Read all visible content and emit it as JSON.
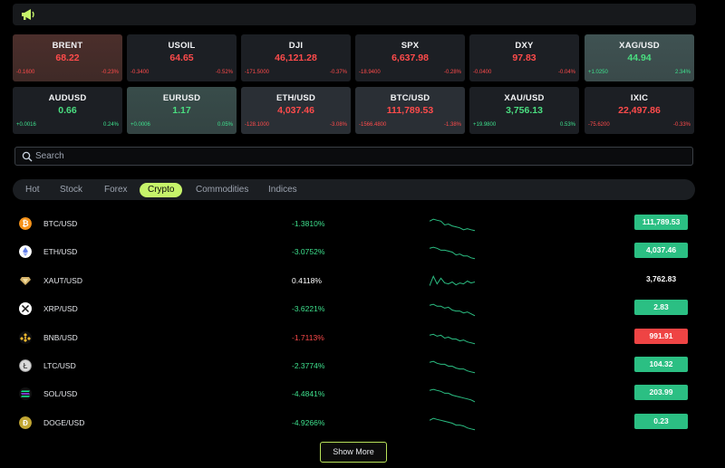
{
  "topbar": {
    "icon": "megaphone-icon"
  },
  "tiles": [
    {
      "symbol": "BRENT",
      "price": "68.22",
      "change": "-0.1600",
      "percent": "-0.23%",
      "dir": "down",
      "style": "hl-red"
    },
    {
      "symbol": "USOIL",
      "price": "64.65",
      "change": "-0.3400",
      "percent": "-0.52%",
      "dir": "down",
      "style": ""
    },
    {
      "symbol": "DJI",
      "price": "46,121.28",
      "change": "-171.5000",
      "percent": "-0.37%",
      "dir": "down",
      "style": ""
    },
    {
      "symbol": "SPX",
      "price": "6,637.98",
      "change": "-18.9400",
      "percent": "-0.28%",
      "dir": "down",
      "style": ""
    },
    {
      "symbol": "DXY",
      "price": "97.83",
      "change": "-0.0400",
      "percent": "-0.04%",
      "dir": "down",
      "style": ""
    },
    {
      "symbol": "XAG/USD",
      "price": "44.94",
      "change": "+1.0250",
      "percent": "2.34%",
      "dir": "up",
      "style": "hl-green"
    },
    {
      "symbol": "AUDUSD",
      "price": "0.66",
      "change": "+0.0016",
      "percent": "0.24%",
      "dir": "up",
      "style": ""
    },
    {
      "symbol": "EURUSD",
      "price": "1.17",
      "change": "+0.0006",
      "percent": "0.05%",
      "dir": "up",
      "style": "hl-green-2"
    },
    {
      "symbol": "ETH/USD",
      "price": "4,037.46",
      "change": "-128.1000",
      "percent": "-3.08%",
      "dir": "down",
      "style": "hl-gray"
    },
    {
      "symbol": "BTC/USD",
      "price": "111,789.53",
      "change": "-1566.4800",
      "percent": "-1.38%",
      "dir": "down",
      "style": "hl-gray"
    },
    {
      "symbol": "XAU/USD",
      "price": "3,756.13",
      "change": "+19.9800",
      "percent": "0.53%",
      "dir": "up",
      "style": ""
    },
    {
      "symbol": "IXIC",
      "price": "22,497.86",
      "change": "-75.6200",
      "percent": "-0.33%",
      "dir": "down",
      "style": ""
    }
  ],
  "search": {
    "placeholder": "Search",
    "value": ""
  },
  "tabs": [
    {
      "label": "Hot",
      "active": false
    },
    {
      "label": "Stock",
      "active": false
    },
    {
      "label": "Forex",
      "active": false
    },
    {
      "label": "Crypto",
      "active": true
    },
    {
      "label": "Commodities",
      "active": false
    },
    {
      "label": "Indices",
      "active": false
    }
  ],
  "rows": [
    {
      "pair": "BTC/USD",
      "percent": "-1.3810%",
      "pct_color": "pos",
      "price": "111,789.53",
      "price_style": "up",
      "icon": "bitcoin-icon",
      "icon_color": "#f7931a",
      "spark": [
        6,
        4,
        5,
        6,
        10,
        9,
        11,
        12,
        13,
        15,
        14,
        15,
        16
      ]
    },
    {
      "pair": "ETH/USD",
      "percent": "-3.0752%",
      "pct_color": "pos",
      "price": "4,037.46",
      "price_style": "up",
      "icon": "ethereum-icon",
      "icon_color": "#ffffff",
      "spark": [
        5,
        4,
        5,
        7,
        7,
        8,
        9,
        12,
        11,
        13,
        13,
        15,
        16
      ]
    },
    {
      "pair": "XAUT/USD",
      "percent": "0.4118%",
      "pct_color": "neu",
      "price": "3,762.83",
      "price_style": "flat",
      "icon": "tether-gold-icon",
      "icon_color": "#d4b26a",
      "spark": [
        14,
        4,
        12,
        6,
        11,
        12,
        10,
        13,
        11,
        12,
        9,
        11,
        10
      ]
    },
    {
      "pair": "XRP/USD",
      "percent": "-3.6221%",
      "pct_color": "pos",
      "price": "2.83",
      "price_style": "up",
      "icon": "xrp-icon",
      "icon_color": "#ffffff",
      "spark": [
        5,
        4,
        6,
        6,
        8,
        7,
        10,
        11,
        11,
        13,
        12,
        14,
        16
      ]
    },
    {
      "pair": "BNB/USD",
      "percent": "-1.7113%",
      "pct_color": "neg",
      "price": "991.91",
      "price_style": "down",
      "icon": "bnb-icon",
      "icon_color": "#f3ba2f",
      "spark": [
        6,
        5,
        7,
        6,
        9,
        8,
        10,
        10,
        12,
        11,
        13,
        14,
        15
      ]
    },
    {
      "pair": "LTC/USD",
      "percent": "-2.3774%",
      "pct_color": "pos",
      "price": "104.32",
      "price_style": "up",
      "icon": "litecoin-icon",
      "icon_color": "#d9d9d9",
      "spark": [
        5,
        4,
        6,
        7,
        7,
        9,
        9,
        11,
        12,
        12,
        14,
        15,
        16
      ]
    },
    {
      "pair": "SOL/USD",
      "percent": "-4.4841%",
      "pct_color": "pos",
      "price": "203.99",
      "price_style": "up",
      "icon": "solana-icon",
      "icon_color": "#9945ff",
      "spark": [
        5,
        4,
        5,
        6,
        8,
        8,
        10,
        11,
        12,
        13,
        14,
        15,
        17
      ]
    },
    {
      "pair": "DOGE/USD",
      "percent": "-4.9266%",
      "pct_color": "pos",
      "price": "0.23",
      "price_style": "up",
      "icon": "dogecoin-icon",
      "icon_color": "#c2a633",
      "spark": [
        6,
        4,
        5,
        6,
        7,
        8,
        9,
        11,
        11,
        12,
        14,
        15,
        16
      ]
    }
  ],
  "show_more": "Show More",
  "colors": {
    "accent": "#c6f36a",
    "up": "#2bbf83",
    "down": "#ef4444"
  }
}
